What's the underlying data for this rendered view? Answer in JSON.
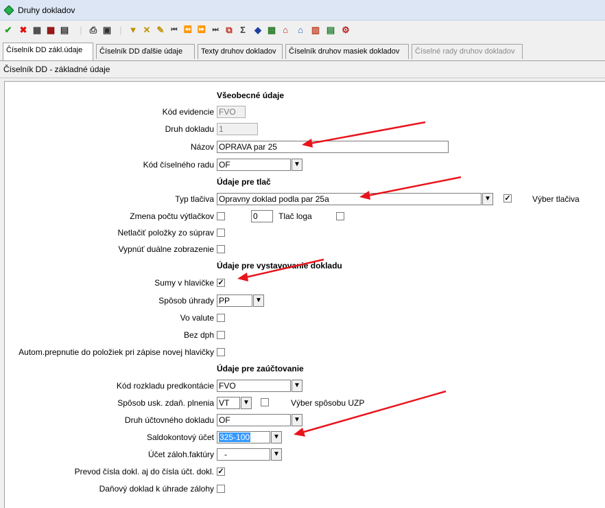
{
  "window": {
    "title": "Druhy dokladov"
  },
  "tabs": [
    {
      "label": "Číselník DD zákl.údaje"
    },
    {
      "label": "Číselník DD ďalšie údaje"
    },
    {
      "label": "Texty druhov dokladov"
    },
    {
      "label": "Číselník druhov masiek dokladov"
    },
    {
      "label": "Číselné rady druhov dokladov"
    }
  ],
  "section_title": "Číselník DD - základné údaje",
  "general": {
    "header": "Všeobecné údaje",
    "kod_evidencie": {
      "label": "Kód evidencie",
      "value": "FVO"
    },
    "druh_dokladu": {
      "label": "Druh dokladu",
      "value": "1"
    },
    "nazov": {
      "label": "Názov",
      "value": "OPRAVA par 25"
    },
    "kod_ciselneho_radu": {
      "label": "Kód číselného radu",
      "value": "OF"
    }
  },
  "print": {
    "header": "Údaje pre tlač",
    "typ_tlaciva": {
      "label": "Typ tlačiva",
      "value": "Opravny doklad podla par 25a"
    },
    "vyber_tlaciva": {
      "label": "Výber tlačiva",
      "checked": true
    },
    "zmena_poctu": {
      "label": "Zmena počtu výtlačkov",
      "checked": false,
      "count": "0"
    },
    "tlac_loga": {
      "label": "Tlač loga",
      "checked": false
    },
    "netlacit": {
      "label": "Netlačiť položky zo súprav",
      "checked": false
    },
    "vypnut_dualne": {
      "label": "Vypnúť duálne zobrazenie",
      "checked": false
    }
  },
  "issue": {
    "header": "Údaje pre vystavovanie dokladu",
    "sumy_v_hlavicke": {
      "label": "Sumy v hlavičke",
      "checked": true
    },
    "sposob_uhrady": {
      "label": "Spôsob úhrady",
      "value": "PP"
    },
    "vo_valute": {
      "label": "Vo valute",
      "checked": false
    },
    "bez_dph": {
      "label": "Bez dph",
      "checked": false
    },
    "autom_prepnutie": {
      "label": "Autom.prepnutie do položiek pri zápise novej hlavičky",
      "checked": false
    }
  },
  "accounting": {
    "header": "Údaje pre zaúčtovanie",
    "kod_rozkladu": {
      "label": "Kód rozkladu predkontácie",
      "value": "FVO"
    },
    "sposob_usk": {
      "label": "Spôsob usk. zdaň. plnenia",
      "value": "VT"
    },
    "vyber_uzp": {
      "label": "Výber spôsobu UZP",
      "checked": false
    },
    "druh_uctovneho": {
      "label": "Druh účtovného dokladu",
      "value": "OF"
    },
    "saldokontovy": {
      "label": "Saldokontový účet",
      "value": "325-100"
    },
    "ucet_zaloh": {
      "label": "Účet záloh.faktúry",
      "value": "-"
    },
    "prevod_cisla": {
      "label": "Prevod čísla dokl. aj do čísla účt. dokl.",
      "checked": true
    },
    "danovy_doklad": {
      "label": "Daňový doklad k úhrade zálohy",
      "checked": false
    }
  },
  "icons": [
    "confirm-icon",
    "cancel-icon",
    "grid-icon",
    "grid-edit-icon",
    "grid-delete-icon",
    "print-icon",
    "preview-icon",
    "filter-icon",
    "filter-clear-icon",
    "filter-edit-icon",
    "first-icon",
    "prev-icon",
    "next-icon",
    "last-icon",
    "copy-icon",
    "sum-icon",
    "export-icon",
    "calendar-icon",
    "home-icon",
    "house-icon",
    "chart-icon",
    "table-icon",
    "settings-icon"
  ],
  "colors": {
    "accent": "#3399ff",
    "arrow": "#e8141c",
    "confirm": "#1aa01a",
    "cancel": "#e01010"
  }
}
